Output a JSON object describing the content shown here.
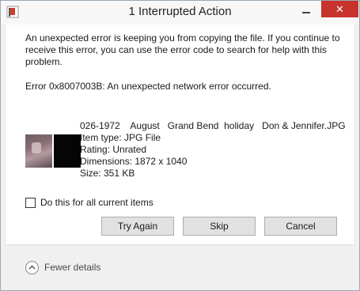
{
  "window": {
    "title": "1 Interrupted Action",
    "close_glyph": "✕"
  },
  "message": {
    "text": "An unexpected error is keeping you from copying the file. If you continue to receive this error, you can use the error code to search for help with this problem.",
    "error": "Error 0x8007003B: An unexpected network error occurred."
  },
  "file": {
    "name": "026-1972    August   Grand Bend  holiday   Don & Jennifer.JPG",
    "type": "Item type: JPG File",
    "rating": "Rating: Unrated",
    "dimensions": "Dimensions: 1872 x 1040",
    "size": "Size: 351 KB"
  },
  "checkbox": {
    "label": "Do this for all current items",
    "checked": false
  },
  "buttons": {
    "try_again": "Try Again",
    "skip": "Skip",
    "cancel": "Cancel"
  },
  "footer": {
    "details_label": "Fewer details"
  },
  "icons": {
    "title_icon": "warning-flag-icon",
    "details_icon": "chevron-up-icon"
  }
}
